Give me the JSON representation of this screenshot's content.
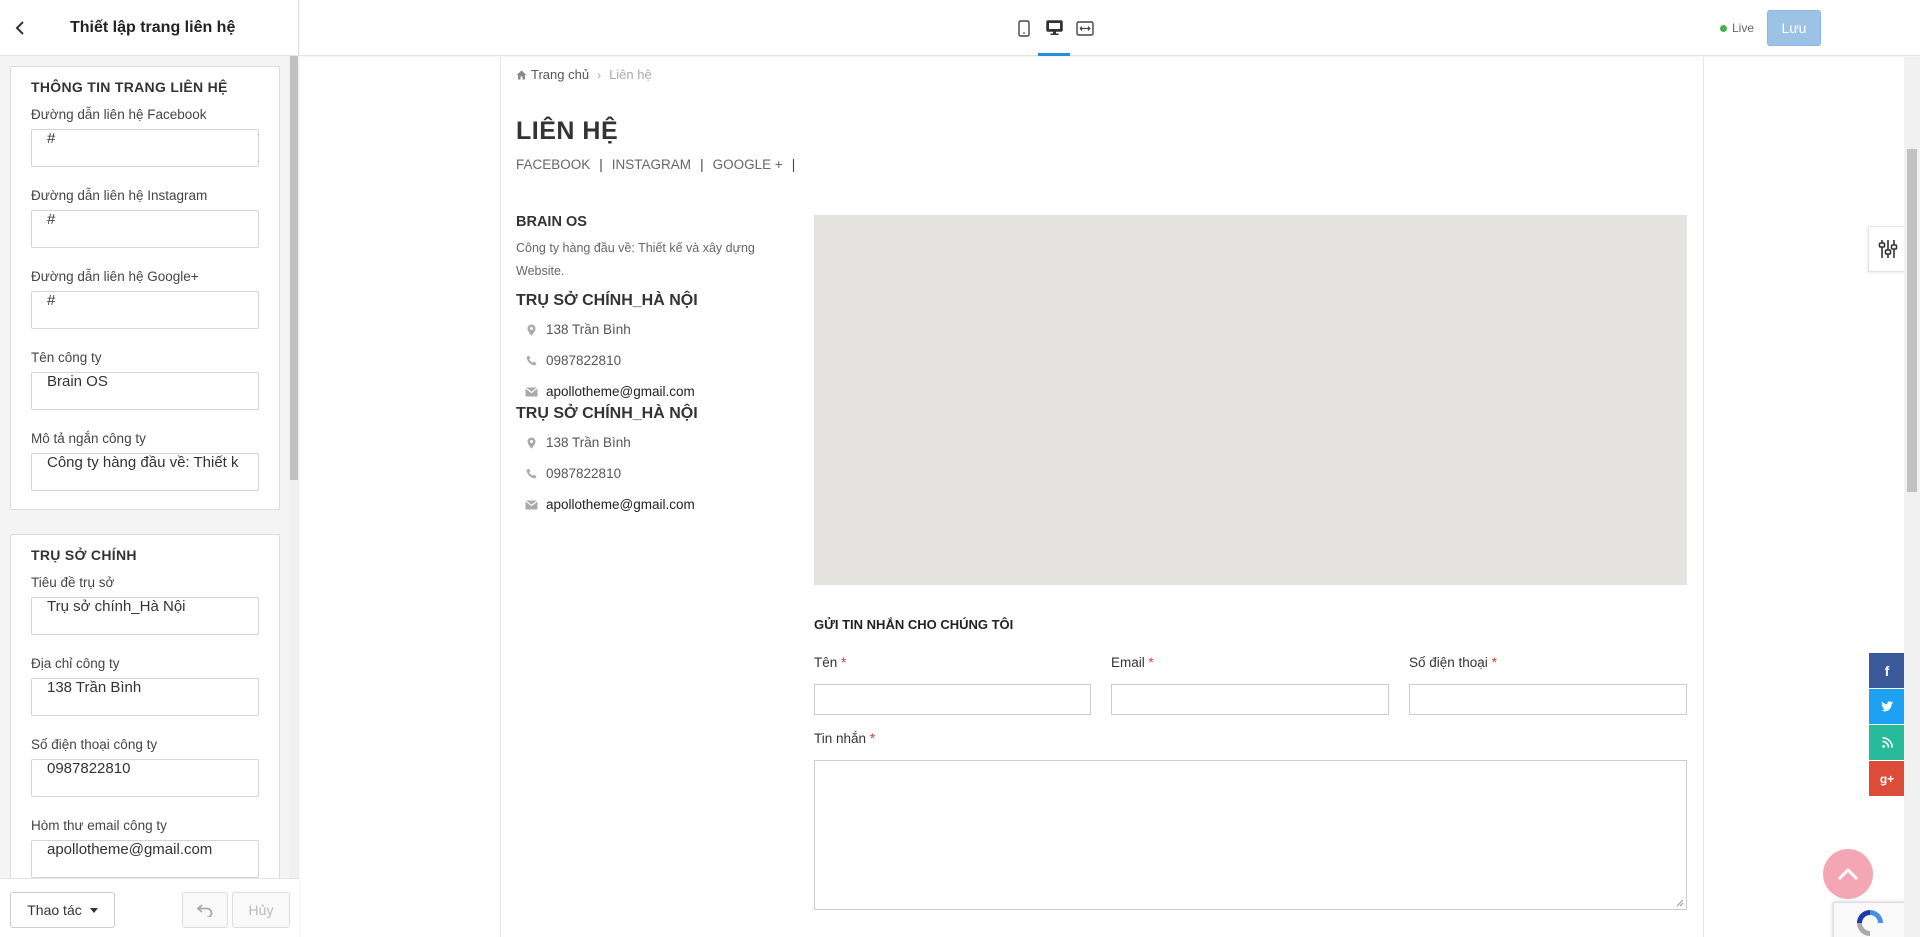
{
  "sidebar": {
    "title": "Thiết lập trang liên hệ",
    "contact_section": {
      "title": "THÔNG TIN TRANG LIÊN HỆ",
      "fields": [
        {
          "label": "Đường dẫn liên hệ Facebook",
          "value": "#"
        },
        {
          "label": "Đường dẫn liên hệ Instagram",
          "value": "#"
        },
        {
          "label": "Đường dẫn liên hệ Google+",
          "value": "#"
        },
        {
          "label": "Tên công ty",
          "value": "Brain OS"
        },
        {
          "label": "Mô tả ngắn công ty",
          "value": "Công ty hàng đầu về: Thiết k"
        }
      ]
    },
    "hq_section": {
      "title": "TRỤ SỞ CHÍNH",
      "fields": [
        {
          "label": "Tiêu đề trụ sở",
          "value": "Trụ sở chính_Hà Nội"
        },
        {
          "label": "Địa chỉ công ty",
          "value": "138 Trần Bình"
        },
        {
          "label": "Số điện thoại công ty",
          "value": "0987822810"
        },
        {
          "label": "Hòm thư email công ty",
          "value": "apollotheme@gmail.com"
        }
      ]
    },
    "footer": {
      "actions_label": "Thao tác",
      "cancel_label": "Hủy"
    }
  },
  "topbar": {
    "live_label": "Live",
    "save_label": "Lưu",
    "colors": {
      "accent": "#1f8fe0",
      "save_bg": "#9cc3e6",
      "live_dot": "#4caf50"
    },
    "device_icons": [
      "tablet-icon",
      "desktop-icon",
      "fullwidth-icon"
    ]
  },
  "preview": {
    "breadcrumb": {
      "home": "Trang chủ",
      "current": "Liên hệ"
    },
    "title": "LIÊN HỆ",
    "social_links": [
      "FACEBOOK",
      "INSTAGRAM",
      "GOOGLE +"
    ],
    "company": {
      "name": "BRAIN OS",
      "description": "Công ty hàng đầu về: Thiết kế và xây dựng Website."
    },
    "offices": [
      {
        "title": "TRỤ SỞ CHÍNH_HÀ NỘI",
        "address": "138 Trần Bình",
        "phone": "0987822810",
        "email": "apollotheme@gmail.com"
      },
      {
        "title": "TRỤ SỞ CHÍNH_HÀ NỘI",
        "address": "138 Trần Bình",
        "phone": "0987822810",
        "email": "apollotheme@gmail.com"
      }
    ],
    "form": {
      "title": "GỬI TIN NHẮN CHO CHÚNG TÔI",
      "name_label": "Tên",
      "email_label": "Email",
      "phone_label": "Số điện thoại",
      "message_label": "Tin nhắn",
      "required_mark": "*"
    },
    "share_colors": {
      "facebook": "#3b5998",
      "twitter": "#1da1f2",
      "rss": "#26b99a",
      "google": "#dd4b39"
    }
  }
}
